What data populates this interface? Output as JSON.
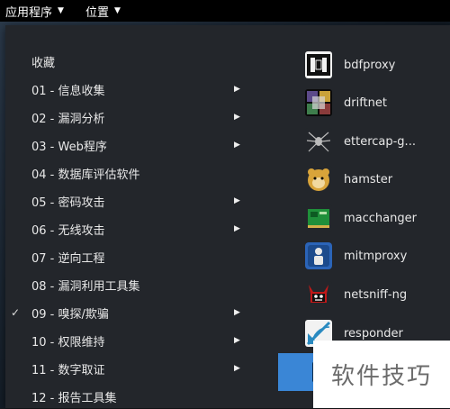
{
  "topbar": {
    "applications_label": "应用程序",
    "places_label": "位置"
  },
  "categories": [
    {
      "label": "收藏",
      "has_submenu": false,
      "checked": false
    },
    {
      "label": "01 - 信息收集",
      "has_submenu": true,
      "checked": false
    },
    {
      "label": "02 - 漏洞分析",
      "has_submenu": true,
      "checked": false
    },
    {
      "label": "03 - Web程序",
      "has_submenu": true,
      "checked": false
    },
    {
      "label": "04 - 数据库评估软件",
      "has_submenu": false,
      "checked": false
    },
    {
      "label": "05 - 密码攻击",
      "has_submenu": true,
      "checked": false
    },
    {
      "label": "06 - 无线攻击",
      "has_submenu": true,
      "checked": false
    },
    {
      "label": "07 - 逆向工程",
      "has_submenu": false,
      "checked": false
    },
    {
      "label": "08 - 漏洞利用工具集",
      "has_submenu": false,
      "checked": false
    },
    {
      "label": "09 - 嗅探/欺骗",
      "has_submenu": true,
      "checked": true
    },
    {
      "label": "10 - 权限维持",
      "has_submenu": true,
      "checked": false
    },
    {
      "label": "11 - 数字取证",
      "has_submenu": true,
      "checked": false
    },
    {
      "label": "12 - 报告工具集",
      "has_submenu": false,
      "checked": false
    }
  ],
  "apps": [
    {
      "name": "bdfproxy",
      "icon": "bdfproxy-icon"
    },
    {
      "name": "driftnet",
      "icon": "driftnet-icon"
    },
    {
      "name": "ettercap-g...",
      "icon": "ettercap-spider-icon"
    },
    {
      "name": "hamster",
      "icon": "hamster-icon"
    },
    {
      "name": "macchanger",
      "icon": "network-card-icon"
    },
    {
      "name": "mitmproxy",
      "icon": "person-icon"
    },
    {
      "name": "netsniff-ng",
      "icon": "devil-icon"
    },
    {
      "name": "responder",
      "icon": "responder-icon"
    }
  ],
  "watermark": "软件技巧",
  "colors": {
    "topbar_bg": "#000000",
    "menu_bg": "#23262b",
    "selection": "#3a86d6"
  }
}
